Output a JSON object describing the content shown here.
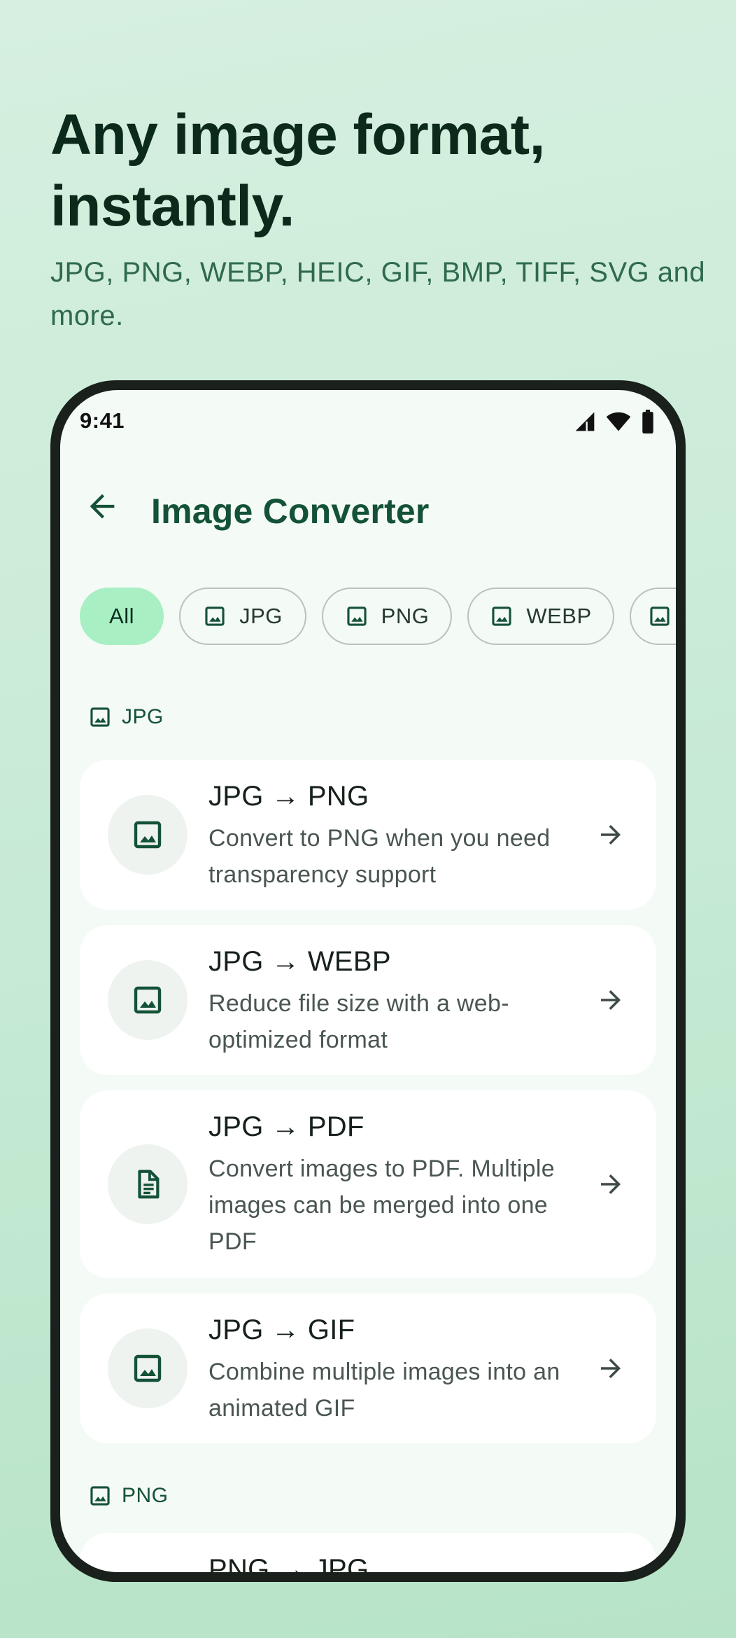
{
  "hero": {
    "headline": "Any image format, instantly.",
    "subline": "JPG, PNG, WEBP, HEIC, GIF, BMP, TIFF, SVG and more."
  },
  "status_bar": {
    "time": "9:41",
    "icons": [
      "signal-icon",
      "wifi-icon",
      "battery-icon"
    ]
  },
  "app_bar": {
    "title": "Image Converter",
    "back_icon": "arrow-back-icon"
  },
  "filters": [
    {
      "label": "All",
      "selected": true
    },
    {
      "label": "JPG",
      "icon": "image-icon"
    },
    {
      "label": "PNG",
      "icon": "image-icon"
    },
    {
      "label": "WEBP",
      "icon": "image-icon"
    },
    {
      "label": "",
      "icon": "image-icon"
    }
  ],
  "sections": [
    {
      "label": "JPG",
      "items": [
        {
          "title": "JPG → PNG",
          "desc": "Convert to PNG when you need transparency support",
          "icon": "image-icon"
        },
        {
          "title": "JPG → WEBP",
          "desc": "Reduce file size with a web-optimized format",
          "icon": "image-icon"
        },
        {
          "title": "JPG → PDF",
          "desc": "Convert images to PDF. Multiple images can be merged into one PDF",
          "icon": "document-icon"
        },
        {
          "title": "JPG → GIF",
          "desc": "Combine multiple images into an animated GIF",
          "icon": "image-icon"
        }
      ]
    },
    {
      "label": "PNG",
      "items": [
        {
          "title": "PNG → JPG",
          "desc": "",
          "icon": "image-icon"
        }
      ]
    }
  ],
  "colors": {
    "accent": "#145238",
    "chip_selected": "#a8efc4",
    "background": "#c9ebd6"
  }
}
